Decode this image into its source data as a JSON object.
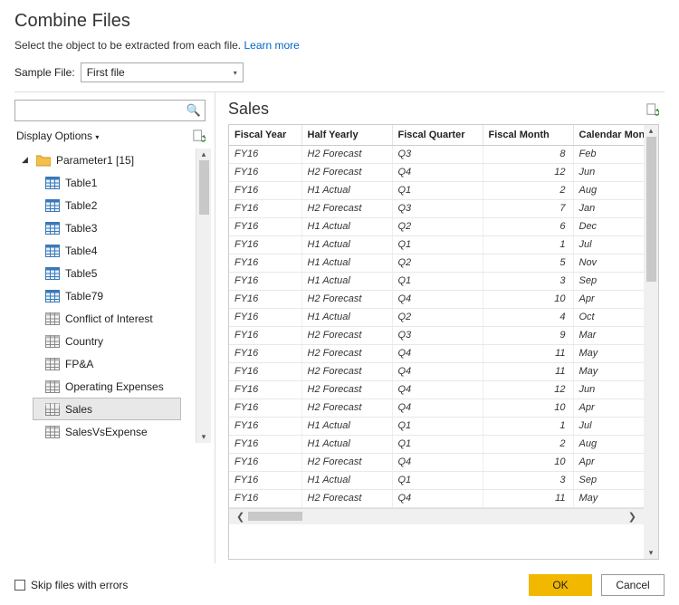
{
  "title": "Combine Files",
  "subtitle_prefix": "Select the object to be extracted from each file. ",
  "subtitle_link": "Learn more",
  "sample_file_label": "Sample File:",
  "sample_file_value": "First file",
  "display_options_label": "Display Options",
  "tree": {
    "root_label": "Parameter1 [15]",
    "items": [
      {
        "label": "Table1",
        "kind": "table-blue"
      },
      {
        "label": "Table2",
        "kind": "table-blue"
      },
      {
        "label": "Table3",
        "kind": "table-blue"
      },
      {
        "label": "Table4",
        "kind": "table-blue"
      },
      {
        "label": "Table5",
        "kind": "table-blue"
      },
      {
        "label": "Table79",
        "kind": "table-blue"
      },
      {
        "label": "Conflict of Interest",
        "kind": "table"
      },
      {
        "label": "Country",
        "kind": "table"
      },
      {
        "label": "FP&A",
        "kind": "table"
      },
      {
        "label": "Operating Expenses",
        "kind": "table"
      },
      {
        "label": "Sales",
        "kind": "table",
        "selected": true
      },
      {
        "label": "SalesVsExpense",
        "kind": "table"
      }
    ]
  },
  "preview": {
    "name": "Sales",
    "columns": [
      "Fiscal Year",
      "Half Yearly",
      "Fiscal Quarter",
      "Fiscal Month",
      "Calendar Month S"
    ],
    "rows": [
      [
        "FY16",
        "H2 Forecast",
        "Q3",
        "8",
        "Feb"
      ],
      [
        "FY16",
        "H2 Forecast",
        "Q4",
        "12",
        "Jun"
      ],
      [
        "FY16",
        "H1 Actual",
        "Q1",
        "2",
        "Aug"
      ],
      [
        "FY16",
        "H2 Forecast",
        "Q3",
        "7",
        "Jan"
      ],
      [
        "FY16",
        "H1 Actual",
        "Q2",
        "6",
        "Dec"
      ],
      [
        "FY16",
        "H1 Actual",
        "Q1",
        "1",
        "Jul"
      ],
      [
        "FY16",
        "H1 Actual",
        "Q2",
        "5",
        "Nov"
      ],
      [
        "FY16",
        "H1 Actual",
        "Q1",
        "3",
        "Sep"
      ],
      [
        "FY16",
        "H2 Forecast",
        "Q4",
        "10",
        "Apr"
      ],
      [
        "FY16",
        "H1 Actual",
        "Q2",
        "4",
        "Oct"
      ],
      [
        "FY16",
        "H2 Forecast",
        "Q3",
        "9",
        "Mar"
      ],
      [
        "FY16",
        "H2 Forecast",
        "Q4",
        "11",
        "May"
      ],
      [
        "FY16",
        "H2 Forecast",
        "Q4",
        "11",
        "May"
      ],
      [
        "FY16",
        "H2 Forecast",
        "Q4",
        "12",
        "Jun"
      ],
      [
        "FY16",
        "H2 Forecast",
        "Q4",
        "10",
        "Apr"
      ],
      [
        "FY16",
        "H1 Actual",
        "Q1",
        "1",
        "Jul"
      ],
      [
        "FY16",
        "H1 Actual",
        "Q1",
        "2",
        "Aug"
      ],
      [
        "FY16",
        "H2 Forecast",
        "Q4",
        "10",
        "Apr"
      ],
      [
        "FY16",
        "H1 Actual",
        "Q1",
        "3",
        "Sep"
      ],
      [
        "FY16",
        "H2 Forecast",
        "Q4",
        "11",
        "May"
      ]
    ]
  },
  "skip_label": "Skip files with errors",
  "ok_label": "OK",
  "cancel_label": "Cancel"
}
